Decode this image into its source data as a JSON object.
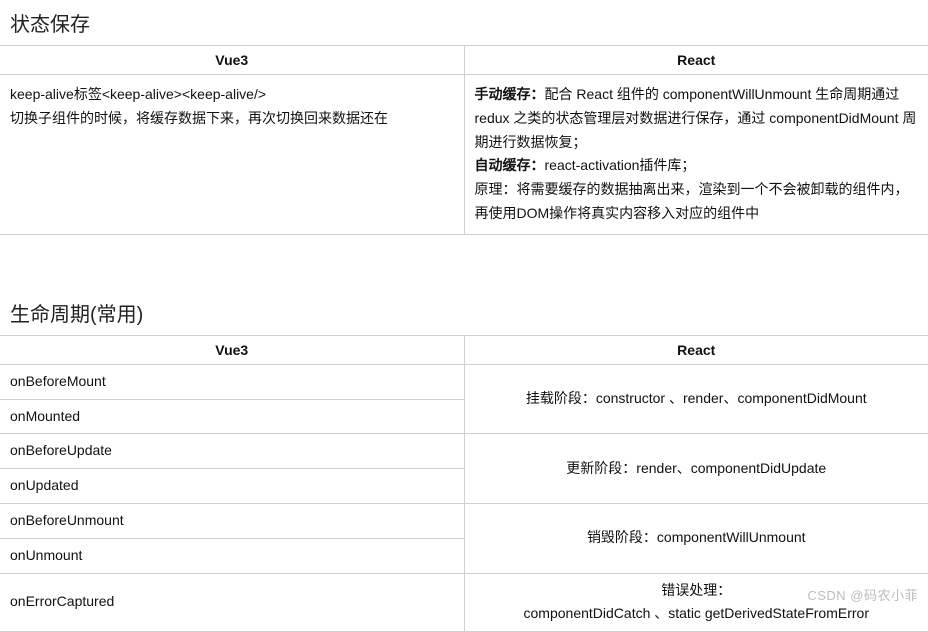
{
  "section1": {
    "title": "状态保存",
    "headers": {
      "left": "Vue3",
      "right": "React"
    },
    "vue": {
      "line1": "keep-alive标签<keep-alive><keep-alive/>",
      "line2": "切换子组件的时候，将缓存数据下来，再次切换回来数据还在"
    },
    "react": {
      "bold1": "手动缓存：",
      "text1": "配合 React 组件的 componentWillUnmount 生命周期通过 redux 之类的状态管理层对数据进行保存，通过 componentDidMount 周期进行数据恢复；",
      "bold2": "自动缓存：",
      "text2": "react-activation插件库；",
      "text3": "原理：将需要缓存的数据抽离出来，渲染到一个不会被卸载的组件内，再使用DOM操作将真实内容移入对应的组件中"
    }
  },
  "section2": {
    "title": "生命周期(常用)",
    "headers": {
      "left": "Vue3",
      "right": "React"
    },
    "rows": [
      {
        "vue": "onBeforeMount",
        "rowspan": 2,
        "react": "挂载阶段：constructor 、render、componentDidMount"
      },
      {
        "vue": "onMounted"
      },
      {
        "vue": "onBeforeUpdate",
        "rowspan": 2,
        "react": "更新阶段：render、componentDidUpdate"
      },
      {
        "vue": "onUpdated"
      },
      {
        "vue": "onBeforeUnmount",
        "rowspan": 2,
        "react": "销毁阶段：componentWillUnmount"
      },
      {
        "vue": "onUnmount"
      },
      {
        "vue": "onErrorCaptured",
        "rowspan": 1,
        "react_l1": "错误处理：",
        "react_l2": "componentDidCatch 、static getDerivedStateFromError"
      }
    ]
  },
  "watermark": "CSDN @码农小菲"
}
